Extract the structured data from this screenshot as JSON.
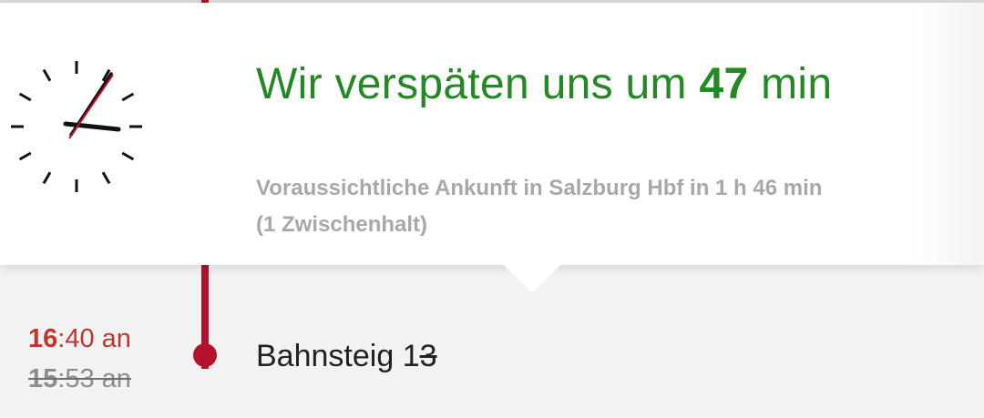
{
  "notice": {
    "headline_prefix": "Wir verspäten uns um",
    "delay_value": "47",
    "delay_unit": "min",
    "estimate_line1": "Voraussichtliche Ankunft in Salzburg Hbf in 1 h 46 min",
    "estimate_line2": "(1 Zwischenhalt)",
    "accent_color": "#238923",
    "icon": "clock-icon"
  },
  "stop": {
    "new_time_hour": "16",
    "new_time_rest": ":40",
    "new_time_suffix": "an",
    "old_time_hour": "15",
    "old_time_rest": ":53",
    "old_time_suffix": "an",
    "platform_label": "Bahnsteig",
    "platform_new": "1",
    "platform_old": "3",
    "rail_color": "#b4122b",
    "delay_color": "#c0362c"
  }
}
